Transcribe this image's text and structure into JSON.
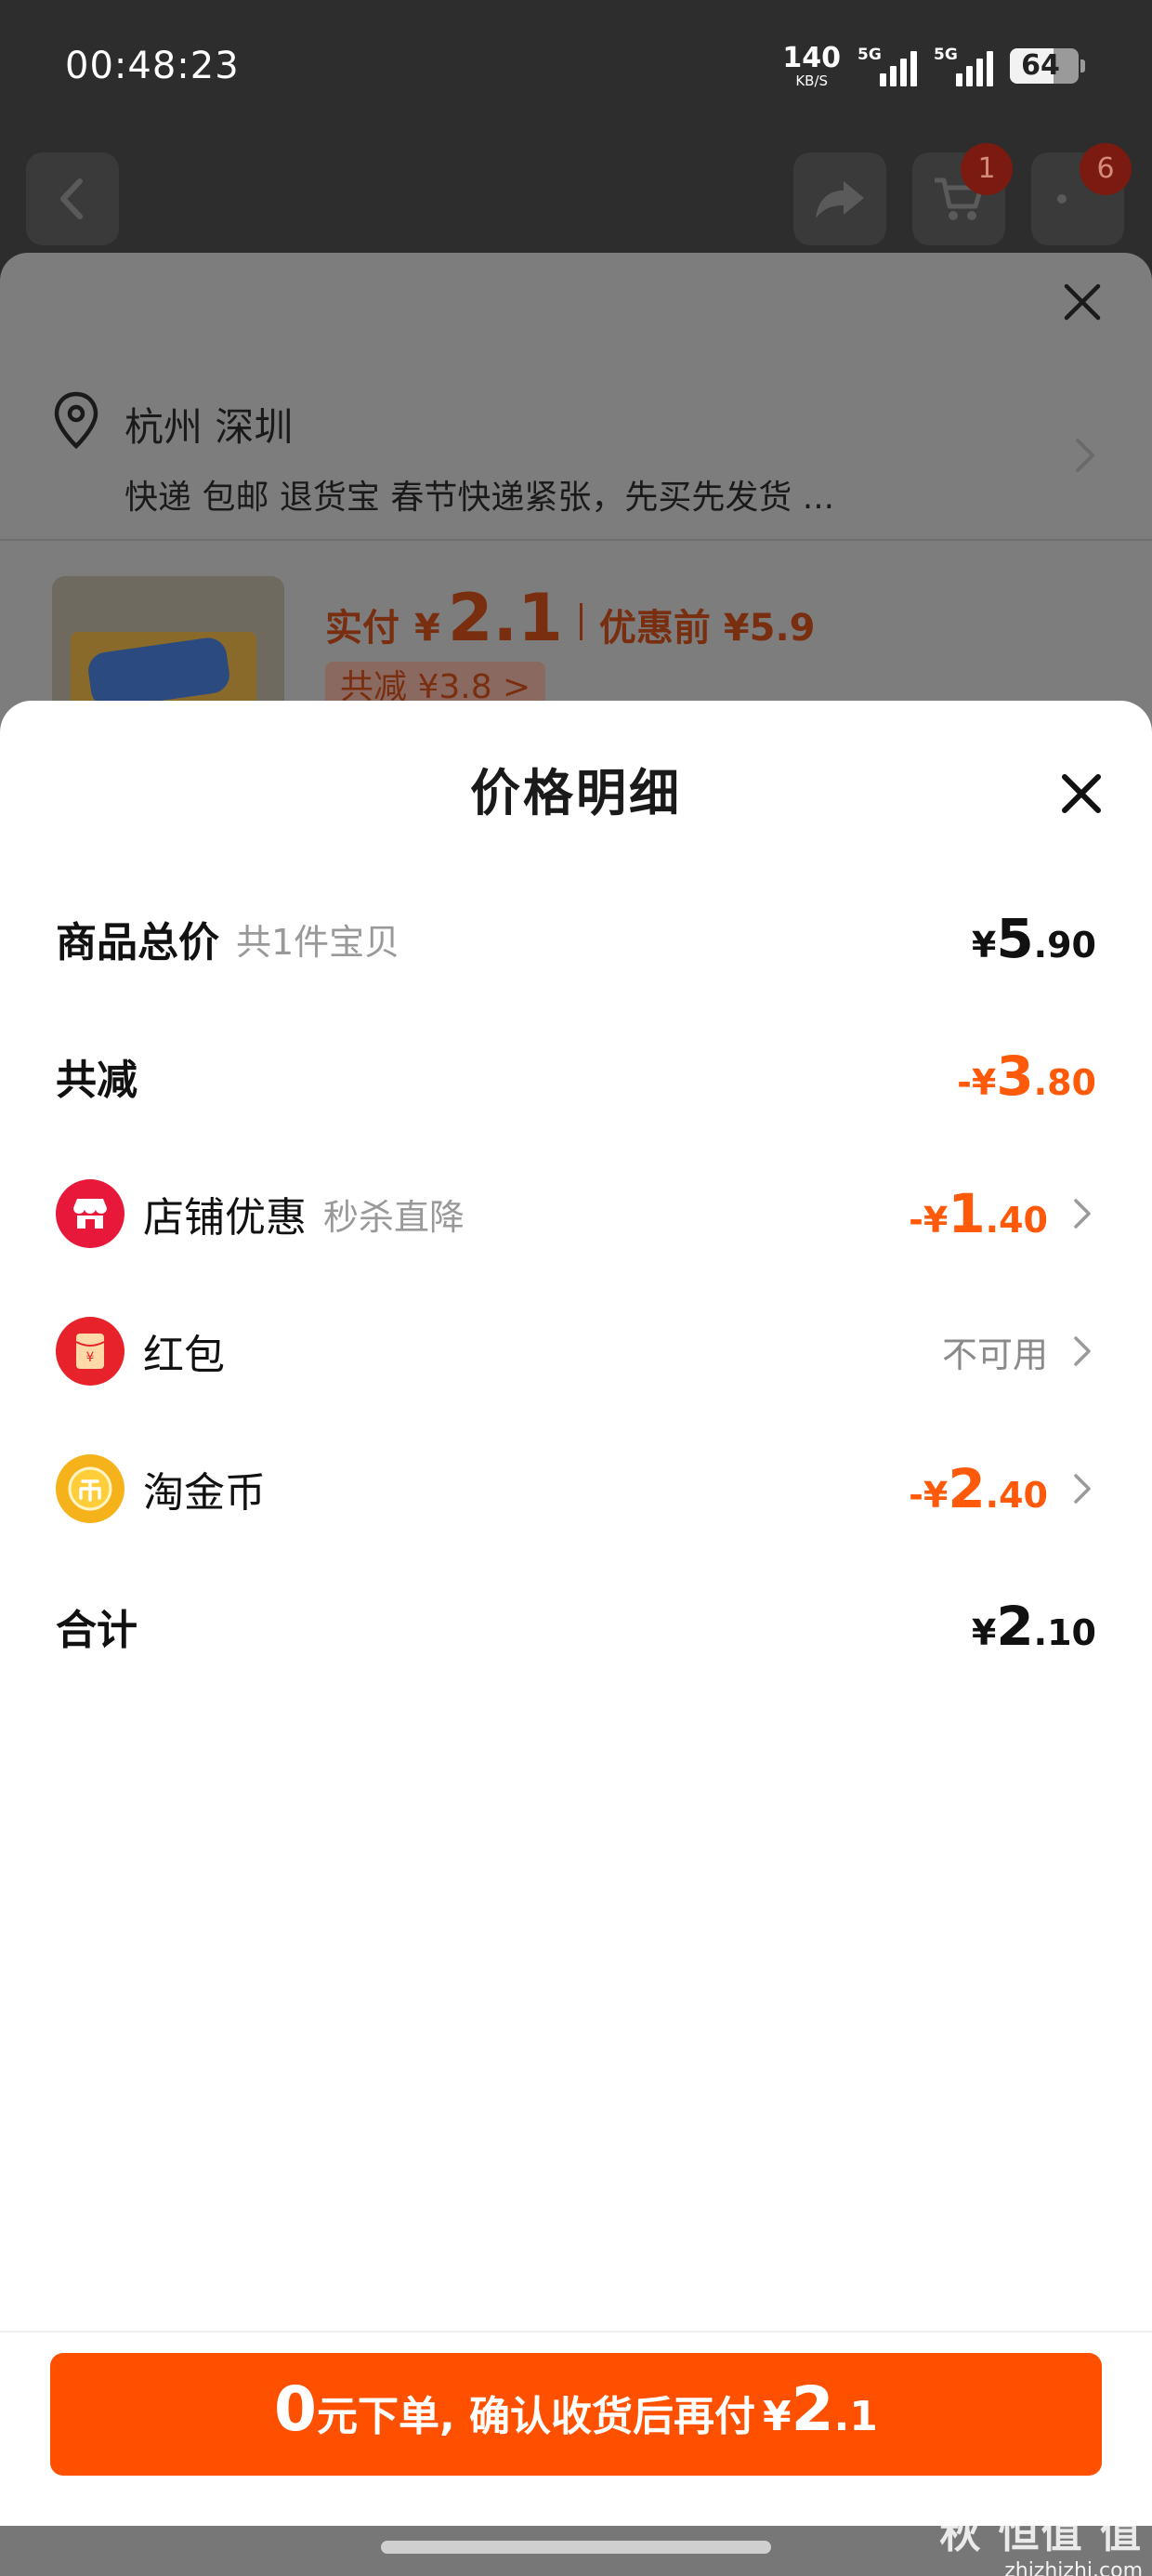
{
  "status_bar": {
    "time": "00:48:23",
    "net_speed_value": "140",
    "net_speed_unit": "KB/S",
    "signal_1": "5G",
    "signal_2": "5G",
    "battery": "64",
    "battery_level_percent": 64
  },
  "background_page": {
    "cart_badge": "1",
    "more_badge": "6",
    "city": "杭州 深圳",
    "delivery_info": "快递 包邮 退货宝 春节快递紧张，先买先发货 ...",
    "price_label": "实付",
    "price_yen": "¥",
    "price_value": "2.1",
    "before_discount": "优惠前 ¥5.9",
    "saving": "共减 ¥3.8 >"
  },
  "sheet": {
    "title": "价格明细",
    "rows": [
      {
        "label": "商品总价",
        "sub": "共1件宝贝",
        "yen": "¥",
        "int": "5",
        "dec": ".90"
      },
      {
        "label": "共减",
        "prefix_yen": "-¥",
        "int": "3",
        "dec": ".80"
      },
      {
        "label": "店铺优惠",
        "sub": "秒杀直降",
        "prefix_yen": "-¥",
        "int": "1",
        "dec": ".40",
        "icon": "store-icon"
      },
      {
        "label": "红包",
        "value": "不可用",
        "icon": "red-packet-icon"
      },
      {
        "label": "淘金币",
        "prefix_yen": "-¥",
        "int": "2",
        "dec": ".40",
        "icon": "coin-icon"
      },
      {
        "label": "合计",
        "yen": "¥",
        "int": "2",
        "dec": ".10"
      }
    ]
  },
  "cta": {
    "big": "0",
    "text": "元下单, 确认收货后再付",
    "yen": "¥",
    "amount_int": "2",
    "amount_dec": ".1"
  },
  "watermark": {
    "line1": "秋 恒值 值",
    "line2": "zhizhizhi.com"
  },
  "colors": {
    "accent": "#ff5000",
    "discount": "#ff5a0a",
    "store_icon": "#e8183a",
    "red_packet_icon": "#e8222a",
    "coin_icon": "#f5b21a"
  }
}
